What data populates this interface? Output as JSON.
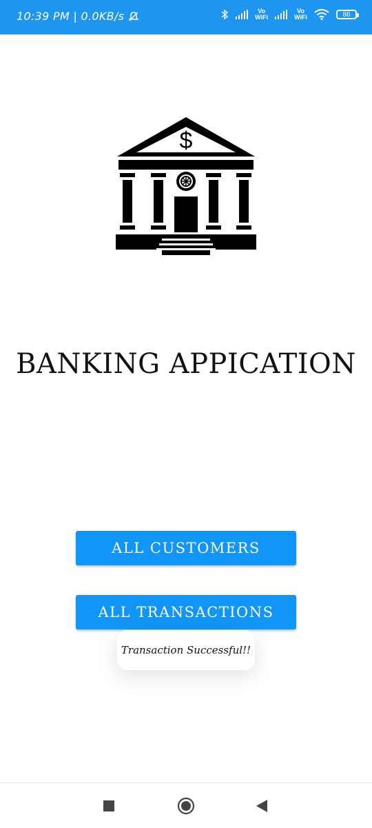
{
  "status_bar": {
    "time_speed": "10:39 PM | 0.0KB/s",
    "icons": [
      "mute-icon",
      "bluetooth-icon",
      "signal-icon",
      "vowifi-icon",
      "signal-icon",
      "vowifi-icon",
      "wifi-icon",
      "battery-icon"
    ],
    "vowifi_label_top": "Vo",
    "vowifi_label_bottom": "WiFi",
    "battery": "86",
    "bg_color": "#1e96f0"
  },
  "main": {
    "logo_icon": "bank-building-icon",
    "title": "BANKING APPICATION",
    "buttons": {
      "customers": "ALL CUSTOMERS",
      "transactions": "ALL TRANSACTIONS"
    },
    "button_color": "#1196f8"
  },
  "toast": {
    "message": "Transaction Successful!!"
  },
  "nav_bar": {
    "icons": [
      "recents-square-icon",
      "home-circle-icon",
      "back-triangle-icon"
    ]
  }
}
